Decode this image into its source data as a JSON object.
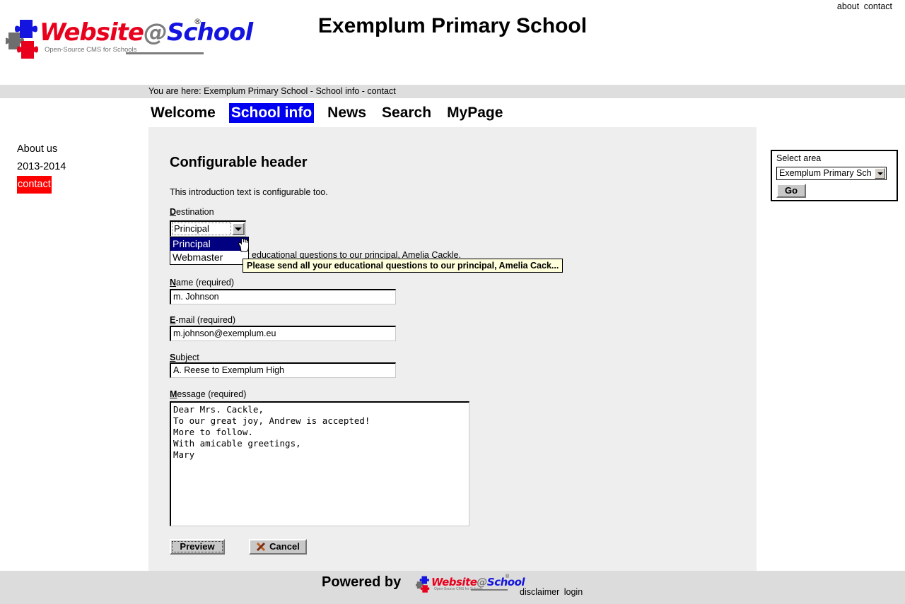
{
  "top": {
    "links": [
      {
        "label": "about"
      },
      {
        "label": "contact"
      }
    ]
  },
  "logo": {
    "word_website": "Website",
    "word_at": "@",
    "word_school": "School",
    "registered_mark": "®",
    "tagline": "Open-Source CMS for Schools"
  },
  "header": {
    "site_title": "Exemplum Primary School",
    "breadcrumb": "You are here: Exemplum Primary School - School info - contact"
  },
  "nav": {
    "items": [
      {
        "label": "Welcome",
        "current": false
      },
      {
        "label": "School info",
        "current": true
      },
      {
        "label": "News",
        "current": false
      },
      {
        "label": "Search",
        "current": false
      },
      {
        "label": "MyPage",
        "current": false
      }
    ]
  },
  "sidebar": {
    "items": [
      {
        "label": "About us",
        "active": false
      },
      {
        "label": "2013-2014",
        "active": false
      },
      {
        "label": "contact",
        "active": true
      }
    ]
  },
  "select_area": {
    "label": "Select area",
    "selected": "Exemplum Primary Sch",
    "options": [
      "Exemplum Primary School"
    ],
    "go_label": "Go"
  },
  "page": {
    "heading": "Configurable header",
    "intro": "This introduction text is configurable too."
  },
  "form": {
    "destination": {
      "label_accesskey": "D",
      "label_rest": "estination",
      "value": "Principal",
      "options": [
        {
          "label": "Principal",
          "selected": true
        },
        {
          "label": "Webmaster",
          "selected": false
        }
      ],
      "body_text": "Please send all your educational questions to our principal, Amelia Cackle.",
      "tooltip": "Please send all your educational questions to our principal, Amelia Cack..."
    },
    "name": {
      "label_accesskey": "N",
      "label_rest": "ame (required)",
      "value": "m. Johnson",
      "placeholder": ""
    },
    "email": {
      "label_accesskey": "E",
      "label_rest": "-mail (required)",
      "value": "m.johnson@exemplum.eu",
      "placeholder": ""
    },
    "subject": {
      "label_accesskey": "S",
      "label_rest": "ubject",
      "value": "A. Reese to Exemplum High",
      "placeholder": ""
    },
    "message": {
      "label_accesskey": "M",
      "label_rest": "essage (required)",
      "value": "Dear Mrs. Cackle,\nTo our great joy, Andrew is accepted!\nMore to follow.\nWith amicable greetings,\nMary",
      "placeholder": ""
    },
    "buttons": {
      "preview": "Preview",
      "cancel": "Cancel"
    }
  },
  "footer": {
    "powered_by": "Powered by",
    "links": [
      {
        "label": "disclaimer"
      },
      {
        "label": "login"
      }
    ]
  },
  "colors": {
    "nav_current_bg": "#0000f0",
    "sidebar_active_bg": "#ff0000",
    "dropdown_selected_bg": "#000080",
    "tooltip_bg": "#ffffdc",
    "content_bg": "#eeeeee",
    "bar_bg": "#dedede",
    "footer_bg": "#dcdcdc",
    "logo_red": "#e8001c",
    "logo_blue": "#1414e0",
    "logo_gray": "#7d7d7d"
  }
}
